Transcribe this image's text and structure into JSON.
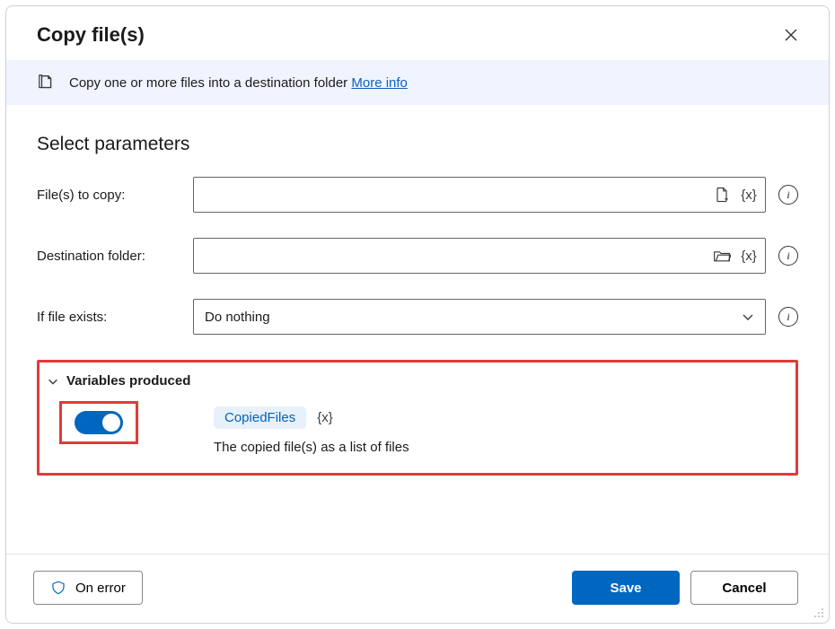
{
  "dialog": {
    "title": "Copy file(s)",
    "info_text": "Copy one or more files into a destination folder",
    "info_link": "More info"
  },
  "params": {
    "heading": "Select parameters",
    "file_label": "File(s) to copy:",
    "file_value": "",
    "dest_label": "Destination folder:",
    "dest_value": "",
    "exists_label": "If file exists:",
    "exists_value": "Do nothing"
  },
  "vars": {
    "heading": "Variables produced",
    "name": "CopiedFiles",
    "desc": "The copied file(s) as a list of files",
    "token": "{x}"
  },
  "footer": {
    "on_error": "On error",
    "save": "Save",
    "cancel": "Cancel"
  },
  "icons": {
    "info_char": "i"
  }
}
